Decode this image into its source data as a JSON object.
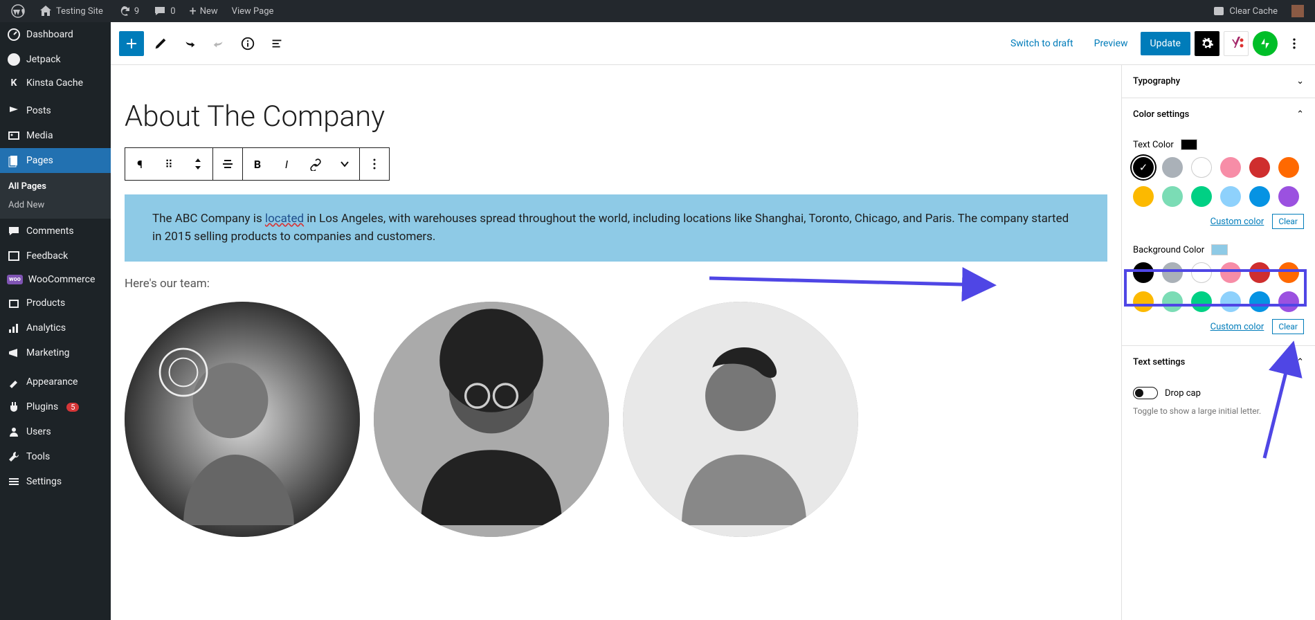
{
  "adminbar": {
    "site": "Testing Site",
    "updates": "9",
    "comments": "0",
    "new": "New",
    "view": "View Page",
    "clear_cache": "Clear Cache"
  },
  "sidebar": {
    "items": [
      {
        "label": "Dashboard"
      },
      {
        "label": "Jetpack"
      },
      {
        "label": "Kinsta Cache"
      },
      {
        "label": "Posts"
      },
      {
        "label": "Media"
      },
      {
        "label": "Pages"
      },
      {
        "label": "Comments"
      },
      {
        "label": "Feedback"
      },
      {
        "label": "WooCommerce"
      },
      {
        "label": "Products"
      },
      {
        "label": "Analytics"
      },
      {
        "label": "Marketing"
      },
      {
        "label": "Appearance"
      },
      {
        "label": "Plugins"
      },
      {
        "label": "Users"
      },
      {
        "label": "Tools"
      },
      {
        "label": "Settings"
      }
    ],
    "plugins_badge": "5",
    "submenu": {
      "all": "All Pages",
      "add": "Add New"
    }
  },
  "editor_header": {
    "switch_draft": "Switch to draft",
    "preview": "Preview",
    "update": "Update"
  },
  "content": {
    "title": "About The Company",
    "paragraph_pre": "The ABC Company is ",
    "paragraph_link": "located",
    "paragraph_post": " in Los Angeles, with warehouses spread throughout the world, including locations like Shanghai, Toronto, Chicago, and Paris. The company started in 2015 selling products to companies and customers.",
    "team_label": "Here's our team:"
  },
  "settings": {
    "typography": "Typography",
    "color_settings": "Color settings",
    "text_color_label": "Text Color",
    "text_color_value": "#000000",
    "bg_color_label": "Background Color",
    "bg_color_value": "#8ecae6",
    "custom_color": "Custom color",
    "clear": "Clear",
    "text_settings": "Text settings",
    "drop_cap": "Drop cap",
    "drop_cap_help": "Toggle to show a large initial letter.",
    "palette": [
      "#000000",
      "#aab1b8",
      "#ffffff",
      "#f78da7",
      "#cf2e2e",
      "#ff6900",
      "#fcb900",
      "#7bdcb5",
      "#00d084",
      "#8ed1fc",
      "#0693e3",
      "#9b51e0"
    ]
  }
}
